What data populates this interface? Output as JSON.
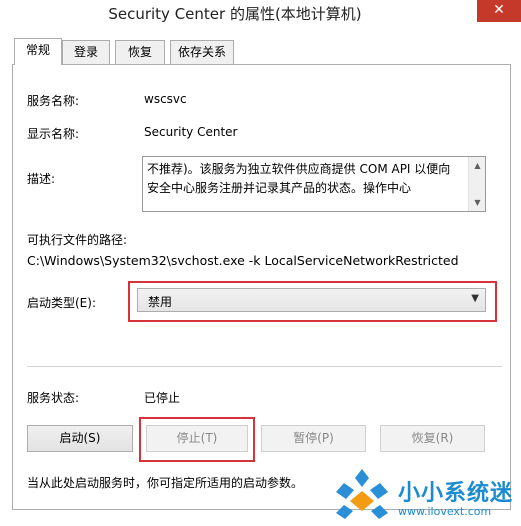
{
  "window": {
    "title": "Security Center 的属性(本地计算机)",
    "close_glyph": "✕"
  },
  "tabs": [
    {
      "label": "常规",
      "active": true
    },
    {
      "label": "登录",
      "active": false
    },
    {
      "label": "恢复",
      "active": false
    },
    {
      "label": "依存关系",
      "active": false
    }
  ],
  "general": {
    "service_name_label": "服务名称:",
    "service_name_value": "wscsvc",
    "display_name_label": "显示名称:",
    "display_name_value": "Security Center",
    "description_label": "描述:",
    "description_value": "不推荐)。该服务为独立软件供应商提供 COM API 以便向安全中心服务注册并记录其产品的状态。操作中心",
    "exe_path_label": "可执行文件的路径:",
    "exe_path_value": "C:\\Windows\\System32\\svchost.exe -k LocalServiceNetworkRestricted",
    "startup_type_label": "启动类型(E):",
    "startup_type_value": "禁用",
    "service_status_label": "服务状态:",
    "service_status_value": "已停止",
    "hint": "当从此处启动服务时，你可指定所适用的启动参数。"
  },
  "buttons": {
    "start": "启动(S)",
    "stop": "停止(T)",
    "pause": "暂停(P)",
    "resume": "恢复(R)"
  },
  "watermark": {
    "brand": "小小系统迷",
    "url": "www.ilovext.com"
  },
  "colors": {
    "highlight": "#d7323a",
    "close": "#c4392a",
    "brand": "#1a8bd0"
  }
}
